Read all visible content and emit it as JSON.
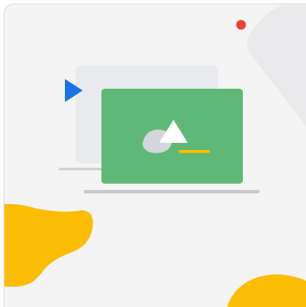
{
  "illustration": {
    "title": "",
    "icons": {
      "back_window": "browser-window-icon",
      "front_window": "image-slide-icon",
      "play": "play-triangle-icon",
      "dot": "notification-dot-icon"
    },
    "colors": {
      "background": "#f4f4f4",
      "front_window": "#5fb976",
      "back_window": "#e8eaed",
      "play_arrow": "#1a73e8",
      "notification_dot": "#ea4335",
      "blob_accent": "#fbbc04",
      "underline_accent": "#fbbc04",
      "shadow_line": "#c9cbcf",
      "corner_shape": "#e9e9ec",
      "mountain_light": "#ffffff",
      "mountain_dark": "#d3d6db"
    }
  }
}
